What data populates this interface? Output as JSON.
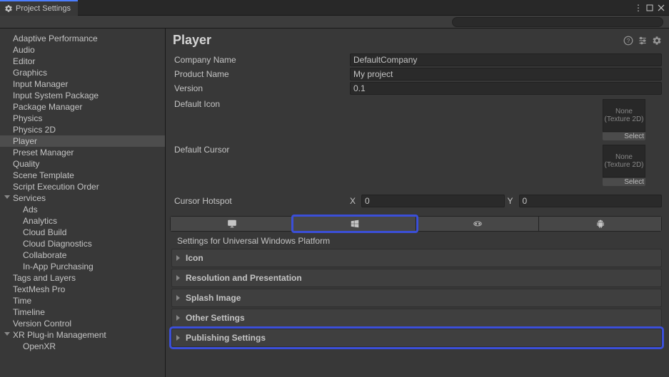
{
  "window": {
    "title": "Project Settings"
  },
  "search": {
    "placeholder": ""
  },
  "sidebar": {
    "items": [
      {
        "label": "Adaptive Performance",
        "level": 0
      },
      {
        "label": "Audio",
        "level": 0
      },
      {
        "label": "Editor",
        "level": 0
      },
      {
        "label": "Graphics",
        "level": 0
      },
      {
        "label": "Input Manager",
        "level": 0
      },
      {
        "label": "Input System Package",
        "level": 0
      },
      {
        "label": "Package Manager",
        "level": 0
      },
      {
        "label": "Physics",
        "level": 0
      },
      {
        "label": "Physics 2D",
        "level": 0
      },
      {
        "label": "Player",
        "level": 0,
        "selected": true
      },
      {
        "label": "Preset Manager",
        "level": 0
      },
      {
        "label": "Quality",
        "level": 0
      },
      {
        "label": "Scene Template",
        "level": 0
      },
      {
        "label": "Script Execution Order",
        "level": 0
      },
      {
        "label": "Services",
        "level": 0,
        "expandable": true
      },
      {
        "label": "Ads",
        "level": 1
      },
      {
        "label": "Analytics",
        "level": 1
      },
      {
        "label": "Cloud Build",
        "level": 1
      },
      {
        "label": "Cloud Diagnostics",
        "level": 1
      },
      {
        "label": "Collaborate",
        "level": 1
      },
      {
        "label": "In-App Purchasing",
        "level": 1
      },
      {
        "label": "Tags and Layers",
        "level": 0
      },
      {
        "label": "TextMesh Pro",
        "level": 0
      },
      {
        "label": "Time",
        "level": 0
      },
      {
        "label": "Timeline",
        "level": 0
      },
      {
        "label": "Version Control",
        "level": 0
      },
      {
        "label": "XR Plug-in Management",
        "level": 0,
        "expandable": true
      },
      {
        "label": "OpenXR",
        "level": 1
      }
    ]
  },
  "content": {
    "title": "Player",
    "company_label": "Company Name",
    "company_value": "DefaultCompany",
    "product_label": "Product Name",
    "product_value": "My project",
    "version_label": "Version",
    "version_value": "0.1",
    "default_icon_label": "Default Icon",
    "default_cursor_label": "Default Cursor",
    "none_label": "None",
    "texture_label": "(Texture 2D)",
    "select_label": "Select",
    "hotspot_label": "Cursor Hotspot",
    "hotspot_x_label": "X",
    "hotspot_x_value": "0",
    "hotspot_y_label": "Y",
    "hotspot_y_value": "0",
    "settings_for": "Settings for Universal Windows Platform",
    "sections": [
      {
        "label": "Icon"
      },
      {
        "label": "Resolution and Presentation"
      },
      {
        "label": "Splash Image"
      },
      {
        "label": "Other Settings"
      },
      {
        "label": "Publishing Settings",
        "highlighted": true
      }
    ]
  }
}
